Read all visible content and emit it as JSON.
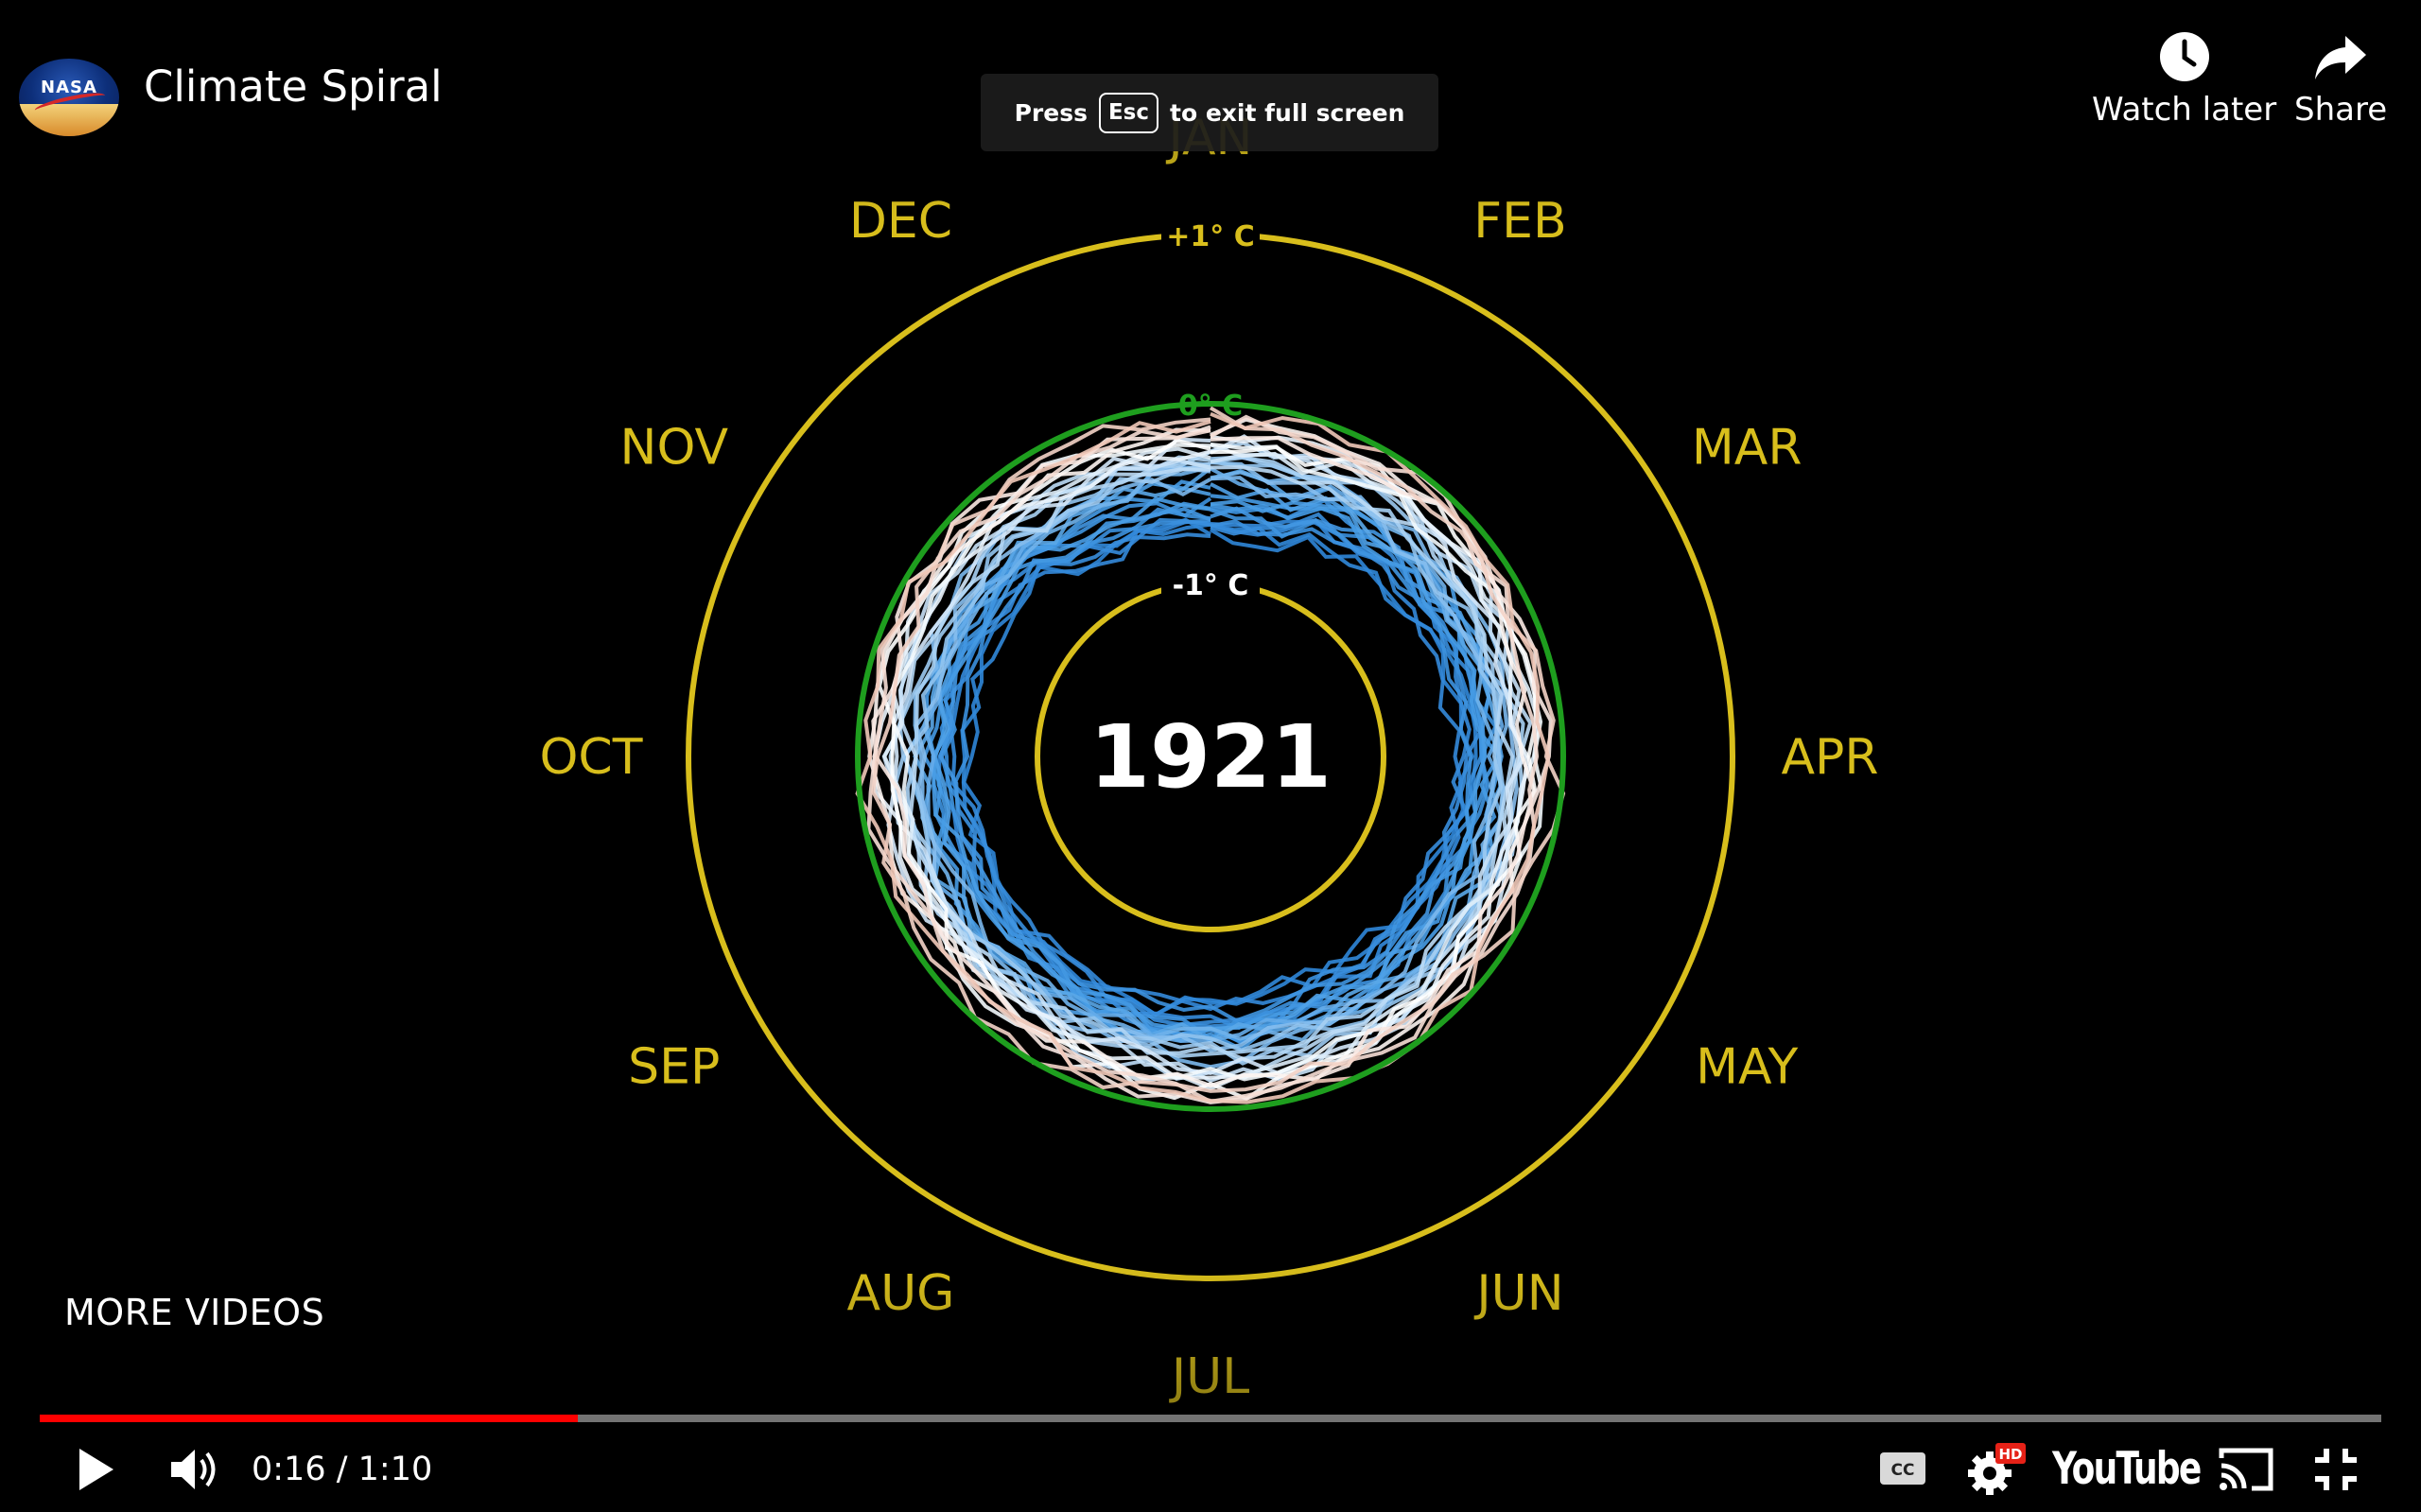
{
  "header": {
    "title": "Climate Spiral",
    "channel_logo_text": "NASA",
    "watch_later_label": "Watch later",
    "share_label": "Share"
  },
  "toast": {
    "prefix": "Press",
    "key": "Esc",
    "suffix": "to exit full screen"
  },
  "more_videos_label": "MORE VIDEOS",
  "player": {
    "time": "0:16 / 1:10",
    "progress_fraction": 0.23,
    "youtube_label": "YouTube",
    "hd_badge": "HD",
    "cc_label": "CC",
    "accent_color": "#ff0000"
  },
  "visualization": {
    "year": "1921",
    "months": [
      "JAN",
      "FEB",
      "MAR",
      "APR",
      "MAY",
      "JUN",
      "JUL",
      "AUG",
      "SEP",
      "OCT",
      "NOV",
      "DEC"
    ],
    "ring_labels": {
      "outer": "+1° C",
      "middle": "0° C",
      "inner": "-1° C"
    },
    "colors": {
      "rings": "#d8be1c",
      "zero_ring": "#1e9e1e",
      "cool": "#4a9ee6",
      "warm": "#f0c8b8"
    }
  }
}
